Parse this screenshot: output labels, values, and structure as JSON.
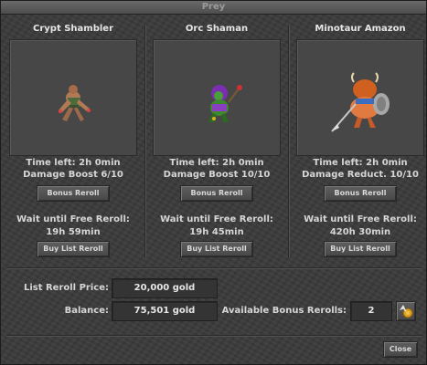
{
  "window": {
    "title": "Prey"
  },
  "slots": [
    {
      "name": "Crypt Shambler",
      "time_left": "Time left: 2h 0min",
      "bonus": "Damage Boost 6/10",
      "bonus_reroll_label": "Bonus Reroll",
      "wait_label": "Wait until Free Reroll:",
      "wait_time": "19h 59min",
      "buy_list_label": "Buy List Reroll"
    },
    {
      "name": "Orc Shaman",
      "time_left": "Time left: 2h 0min",
      "bonus": "Damage Boost 10/10",
      "bonus_reroll_label": "Bonus Reroll",
      "wait_label": "Wait until Free Reroll:",
      "wait_time": "19h 45min",
      "buy_list_label": "Buy List Reroll"
    },
    {
      "name": "Minotaur Amazon",
      "time_left": "Time left: 2h 0min",
      "bonus": "Damage Reduct. 10/10",
      "bonus_reroll_label": "Bonus Reroll",
      "wait_label": "Wait until Free Reroll:",
      "wait_time": "420h 30min",
      "buy_list_label": "Buy List Reroll"
    }
  ],
  "footer": {
    "list_reroll_price_label": "List Reroll Price:",
    "list_reroll_price": "20,000 gold",
    "balance_label": "Balance:",
    "balance": "75,501 gold",
    "bonus_rerolls_label": "Available Bonus Rerolls:",
    "bonus_rerolls": "2",
    "buy_bonus_icon": "coin-arrow-icon",
    "close_label": "Close"
  }
}
